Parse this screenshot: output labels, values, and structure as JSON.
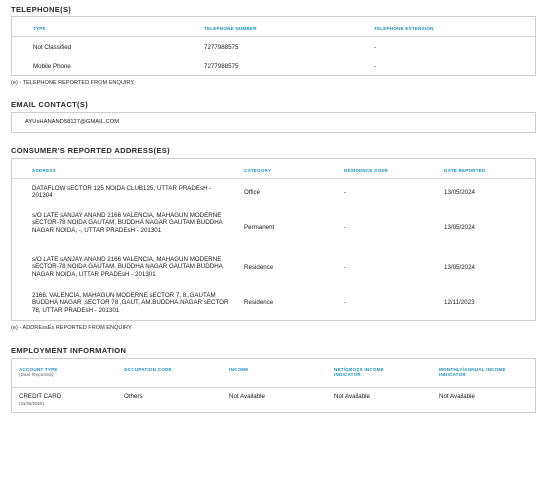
{
  "telephones": {
    "title": "TELEPHONE(S)",
    "headers": {
      "type": "TYPE",
      "number": "TELEPHONE NUMBER",
      "extension": "TELEPHONE EXTENSION"
    },
    "rows": [
      {
        "type": "Not Classified",
        "number": "7277988575",
        "extension": "-"
      },
      {
        "type": "Mobile Phone",
        "number": "7277988575",
        "extension": "-"
      }
    ],
    "note": "(e) - TELEPHONE REPORTED FROM ENQUIRY"
  },
  "email": {
    "title": "EMAIL CONTACT(S)",
    "value": "AYUsHANAND58127@GMAIL.COM"
  },
  "addresses": {
    "title": "CONSUMER'S REPORTED ADDRESS(ES)",
    "headers": {
      "address": "ADDRESS",
      "category": "CATEGORY",
      "residence_code": "RESIDENCE CODE",
      "date_reported": "DATE REPORTED"
    },
    "rows": [
      {
        "address": "DATAFLOW sECTOR 125 NOIDA CLUB125, UTTAR PRADEsH - 201304",
        "category": "Office",
        "residence_code": "-",
        "date_reported": "13/05/2024"
      },
      {
        "address": "s/O LATE sANJAY ANAND 2166 VALENCIA, MAHAGUN MODERNE sECTOR-78 NOIDA GAUTAM, BUDDHA NAGAR GAUTAM BUDDHA NAGAR NOIDA, -, UTTAR PRADEsH - 201301",
        "category": "Permanent",
        "residence_code": "-",
        "date_reported": "13/05/2024"
      },
      {
        "address": "s/O LATE sANJAY ANAND 2166 VALENCIA, MAHAGUN MODERNE sECTOR-78 NOIDA GAUTAM, BUDDHA NAGAR GAUTAM BUDDHA NAGAR NOIDA, UTTAR PRADEsH - 201301",
        "category": "Residence",
        "residence_code": "-",
        "date_reported": "13/05/2024"
      },
      {
        "address": "2166, VALENCIA, MAHAGUN MODERNE sECTOR 7, 8.,GAUTAM BUDDHA NAGAR ,sECTOR 78 ,GAUT, AM.BUDDHA.NAGAR sECTOR 78, UTTAR PRADEsH - 201301",
        "category": "Residence",
        "residence_code": "-",
        "date_reported": "12/11/2023"
      }
    ],
    "note": "(e) - ADDREssEs REPORTED FROM ENQUIRY"
  },
  "employment": {
    "title": "EMPLOYMENT INFORMATION",
    "headers": {
      "account_type": "ACCOUNT TYPE",
      "account_type_sub": "(Date Reported)",
      "occupation_code": "OCCUPATION CODE",
      "income": "INCOME",
      "net_gross": "NET/GROSS INCOME INDICATOR",
      "monthly_annual": "MONTHLY/ANNUAL INCOME INDICATOR"
    },
    "rows": [
      {
        "account_type": "CREDIT CARD",
        "date_reported": "(31/05/2025)",
        "occupation_code": "Others",
        "income": "Not Available",
        "net_gross": "Not Available",
        "monthly_annual": "Not Available"
      }
    ]
  },
  "colors": {
    "accent": "#1f8fb8",
    "border": "#c9cfd4",
    "heading": "#2b2b2b"
  }
}
